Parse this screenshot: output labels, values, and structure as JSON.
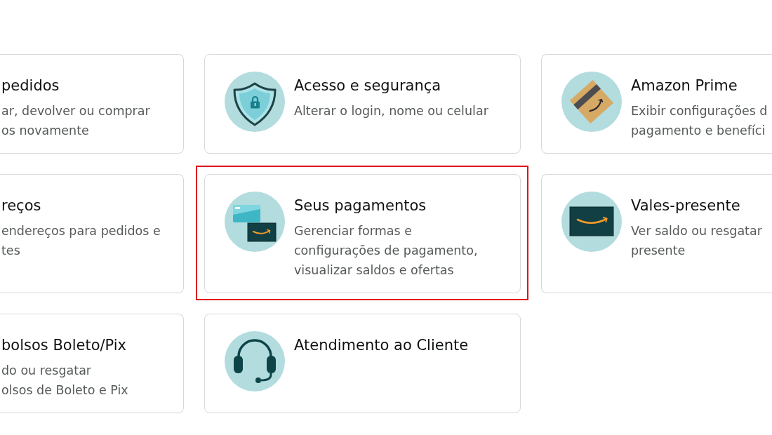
{
  "cards": [
    {
      "kind": "plain",
      "title": "pedidos",
      "description_lines": [
        "ar, devolver ou comprar",
        "os novamente"
      ],
      "highlighted": false
    },
    {
      "kind": "shield",
      "title": "Acesso e segurança",
      "description_lines": [
        "Alterar o login, nome ou celular"
      ],
      "highlighted": false
    },
    {
      "kind": "box",
      "title": "Amazon Prime",
      "description_lines": [
        "Exibir configurações d",
        "pagamento e benefíci"
      ],
      "highlighted": false
    },
    {
      "kind": "plain",
      "title": "reços",
      "description_lines": [
        "endereços para pedidos e",
        "tes"
      ],
      "highlighted": false
    },
    {
      "kind": "cards",
      "title": "Seus pagamentos",
      "description_lines": [
        "Gerenciar formas e",
        "configurações de pagamento,",
        "visualizar saldos e ofertas"
      ],
      "highlighted": true
    },
    {
      "kind": "giftcard",
      "title": "Vales-presente",
      "description_lines": [
        "Ver saldo ou resgatar",
        "presente"
      ],
      "highlighted": false
    },
    {
      "kind": "plain",
      "title": "bolsos Boleto/Pix",
      "description_lines": [
        "do ou resgatar",
        "olsos de Boleto e Pix"
      ],
      "highlighted": false
    },
    {
      "kind": "headset",
      "title": "Atendimento ao Cliente",
      "highlighted": false
    }
  ]
}
